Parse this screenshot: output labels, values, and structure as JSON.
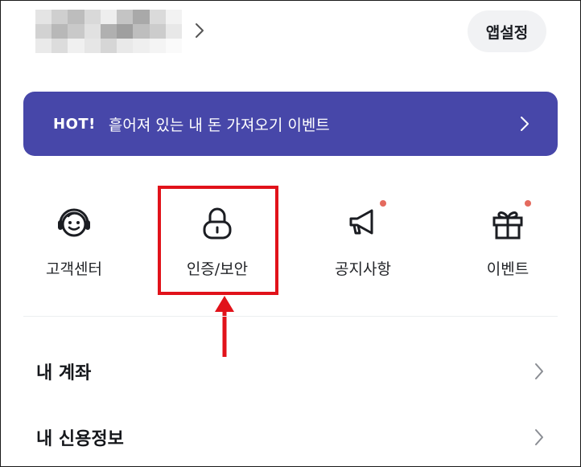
{
  "header": {
    "settings_label": "앱설정"
  },
  "banner": {
    "hot_label": "HOT!",
    "text": "흩어져 있는 내 돈 가져오기 이벤트"
  },
  "menu": {
    "items": [
      {
        "label": "고객센터",
        "icon": "headset-face-icon",
        "has_dot": false
      },
      {
        "label": "인증/보안",
        "icon": "lock-icon",
        "has_dot": false
      },
      {
        "label": "공지사항",
        "icon": "megaphone-icon",
        "has_dot": true
      },
      {
        "label": "이벤트",
        "icon": "gift-icon",
        "has_dot": true
      }
    ]
  },
  "list": {
    "items": [
      {
        "label": "내 계좌"
      },
      {
        "label": "내 신용정보"
      }
    ]
  },
  "colors": {
    "banner_bg": "#4747a9",
    "highlight": "#e1121a",
    "notification_dot": "#e46a5e",
    "settings_bg": "#f1f2f4"
  }
}
